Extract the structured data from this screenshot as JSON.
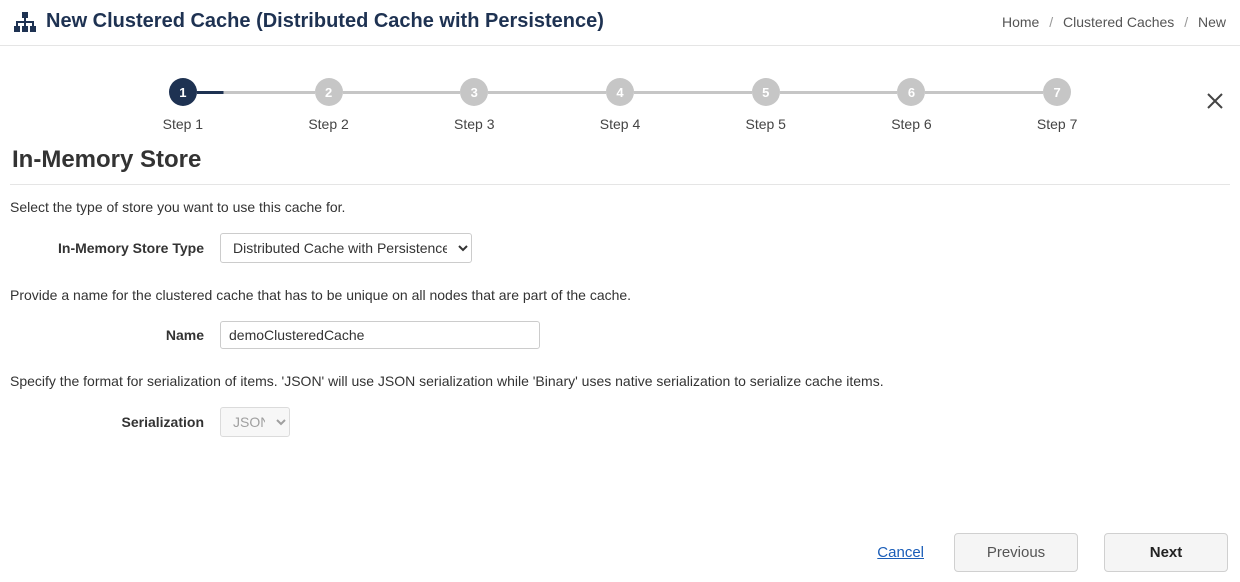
{
  "header": {
    "title": "New Clustered Cache (Distributed Cache with Persistence)"
  },
  "breadcrumb": {
    "items": [
      "Home",
      "Clustered Caches",
      "New"
    ]
  },
  "stepper": {
    "steps": [
      {
        "num": "1",
        "label": "Step 1",
        "active": true
      },
      {
        "num": "2",
        "label": "Step 2",
        "active": false
      },
      {
        "num": "3",
        "label": "Step 3",
        "active": false
      },
      {
        "num": "4",
        "label": "Step 4",
        "active": false
      },
      {
        "num": "5",
        "label": "Step 5",
        "active": false
      },
      {
        "num": "6",
        "label": "Step 6",
        "active": false
      },
      {
        "num": "7",
        "label": "Step 7",
        "active": false
      }
    ]
  },
  "section": {
    "title": "In-Memory Store",
    "storeDesc": "Select the type of store you want to use this cache for.",
    "storeTypeLabel": "In-Memory Store Type",
    "storeTypeValue": "Distributed Cache with Persistence",
    "nameDesc": "Provide a name for the clustered cache that has to be unique on all nodes that are part of the cache.",
    "nameLabel": "Name",
    "nameValue": "demoClusteredCache",
    "serDesc": "Specify the format for serialization of items. 'JSON' will use JSON serialization while 'Binary' uses native serialization to serialize cache items.",
    "serLabel": "Serialization",
    "serValue": "JSON"
  },
  "footer": {
    "cancel": "Cancel",
    "previous": "Previous",
    "next": "Next"
  }
}
